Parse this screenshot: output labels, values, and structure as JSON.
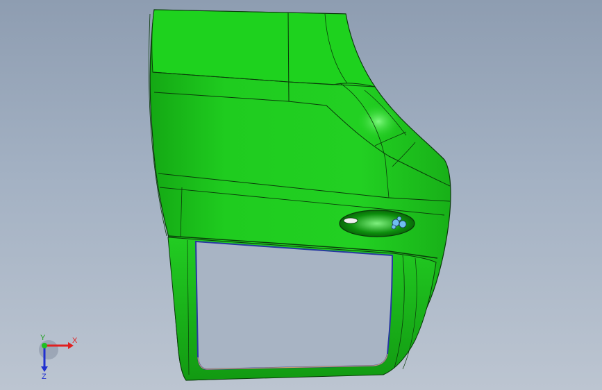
{
  "viewport": {
    "background_top": "#8e9db1",
    "background_bottom": "#bcc5d1"
  },
  "model": {
    "part": "car-door-panel",
    "body_color": "#1ec91e",
    "edge_color": "#0a3a0a",
    "window_frame_color": "#3040a0",
    "handle_color": "#6fbef0"
  },
  "triad": {
    "x_label": "X",
    "y_label": "Y",
    "z_label": "Z",
    "x_color": "#e02020",
    "y_color": "#20c020",
    "z_color": "#2030d0"
  }
}
